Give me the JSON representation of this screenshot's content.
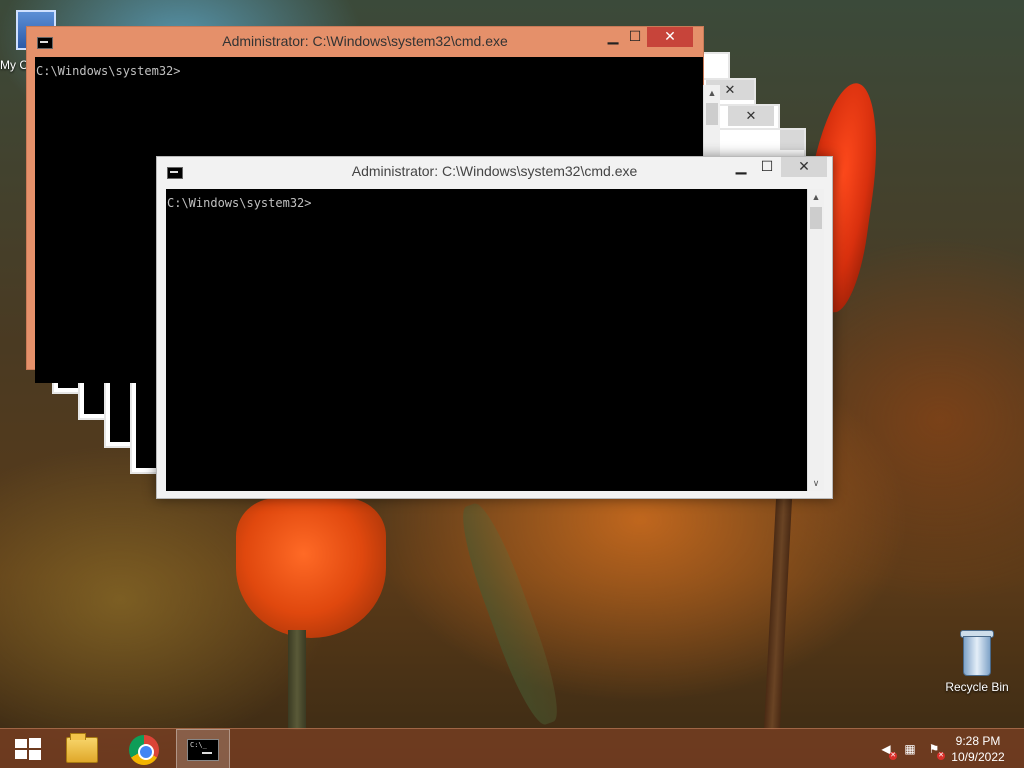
{
  "desktop": {
    "icons": [
      {
        "label": "My C",
        "icon": "computer-icon"
      },
      {
        "label": "Recycle Bin",
        "icon": "recycle-bin-icon"
      }
    ]
  },
  "windows": {
    "back": {
      "title": "Administrator: C:\\Windows\\system32\\cmd.exe",
      "minimize": "▁",
      "maximize": "☐",
      "close": "✕",
      "console_text": "C:\\Windows\\system32>"
    },
    "front": {
      "title": "Administrator: C:\\Windows\\system32\\cmd.exe",
      "minimize": "▁",
      "maximize": "☐",
      "close": "✕",
      "console_text": "C:\\Windows\\system32>",
      "scroll_up": "▲",
      "scroll_down": "∨"
    },
    "ghost_close": "✕"
  },
  "taskbar": {
    "items": [
      {
        "name": "start",
        "icon": "windows-logo-icon"
      },
      {
        "name": "file-explorer",
        "icon": "folder-icon"
      },
      {
        "name": "chrome",
        "icon": "chrome-icon"
      },
      {
        "name": "command-prompt",
        "icon": "terminal-icon",
        "icon_text": "C:\\_"
      }
    ],
    "tray": {
      "icons": [
        "volume-muted-icon",
        "network-icon",
        "action-center-flag-icon"
      ],
      "x_mark": "✕"
    },
    "clock": {
      "time": "9:28 PM",
      "date": "10/9/2022"
    }
  },
  "colors": {
    "active_title_bar": "#e5906a",
    "close_button": "#c7443a",
    "taskbar": "#783e22"
  }
}
